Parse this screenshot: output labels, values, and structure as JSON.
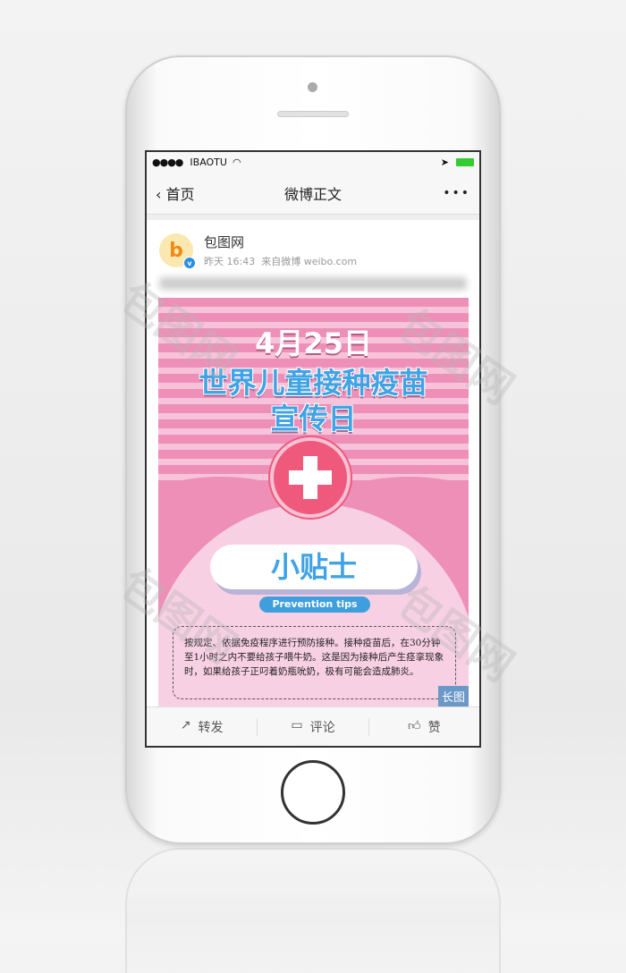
{
  "status": {
    "carrier": "IBAOTU",
    "signal": "●●●●"
  },
  "nav": {
    "back": "首页",
    "title": "微博正文",
    "more": "•••"
  },
  "post": {
    "author": "包图网",
    "avatar_letter": "b",
    "time": "昨天 16:43",
    "source": "来自微博 weibo.com"
  },
  "poster": {
    "date": "4月25日",
    "title1": "世界儿童接种疫苗",
    "title2": "宣传日",
    "tips_title": "小贴士",
    "tips_en": "Prevention tips",
    "body": "按规定、依据免疫程序进行预防接种。接种疫苗后，在30分钟至1小时之内不要给孩子喂牛奶。这是因为接种后产生痉挛现象时，如果给孩子正叼着奶瓶吮奶，极有可能会造成肺炎。",
    "long_image": "长图",
    "colors": {
      "stripe": "#ee8fb7",
      "title": "#3fa3e6",
      "cross": "#ef5a7c"
    }
  },
  "actions": [
    {
      "label": "转发",
      "icon": "share-icon"
    },
    {
      "label": "评论",
      "icon": "comment-icon"
    },
    {
      "label": "赞",
      "icon": "thumbs-up-icon"
    }
  ],
  "watermark": "包图网"
}
